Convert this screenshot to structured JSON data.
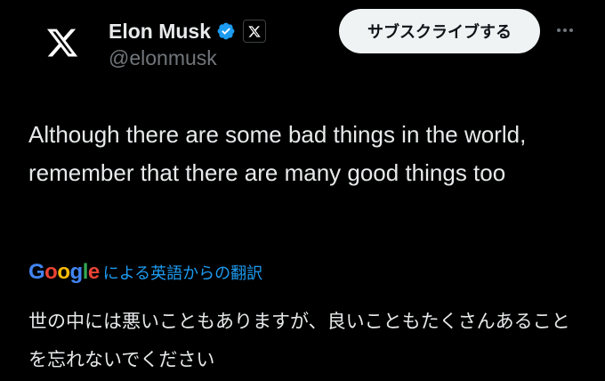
{
  "author": {
    "name": "Elon Musk",
    "handle": "@elonmusk",
    "avatar_icon": "x-logo-icon",
    "verified_icon": "verified-badge-icon",
    "affiliation_icon": "x-logo-icon"
  },
  "actions": {
    "subscribe_label": "サブスクライブする",
    "more_icon": "more-horizontal-icon"
  },
  "tweet": {
    "text": "Although there are some bad things in the world, remember that there are many good things too"
  },
  "translation": {
    "provider": "Google",
    "label": "による英語からの翻訳",
    "text": "世の中には悪いこともありますが、良いこともたくさんあることを忘れないでください"
  },
  "colors": {
    "background": "#000000",
    "text": "#e7e9ea",
    "secondary_text": "#71767b",
    "link": "#1d9bf0",
    "verified": "#1d9bf0",
    "button_bg": "#eff3f4"
  }
}
